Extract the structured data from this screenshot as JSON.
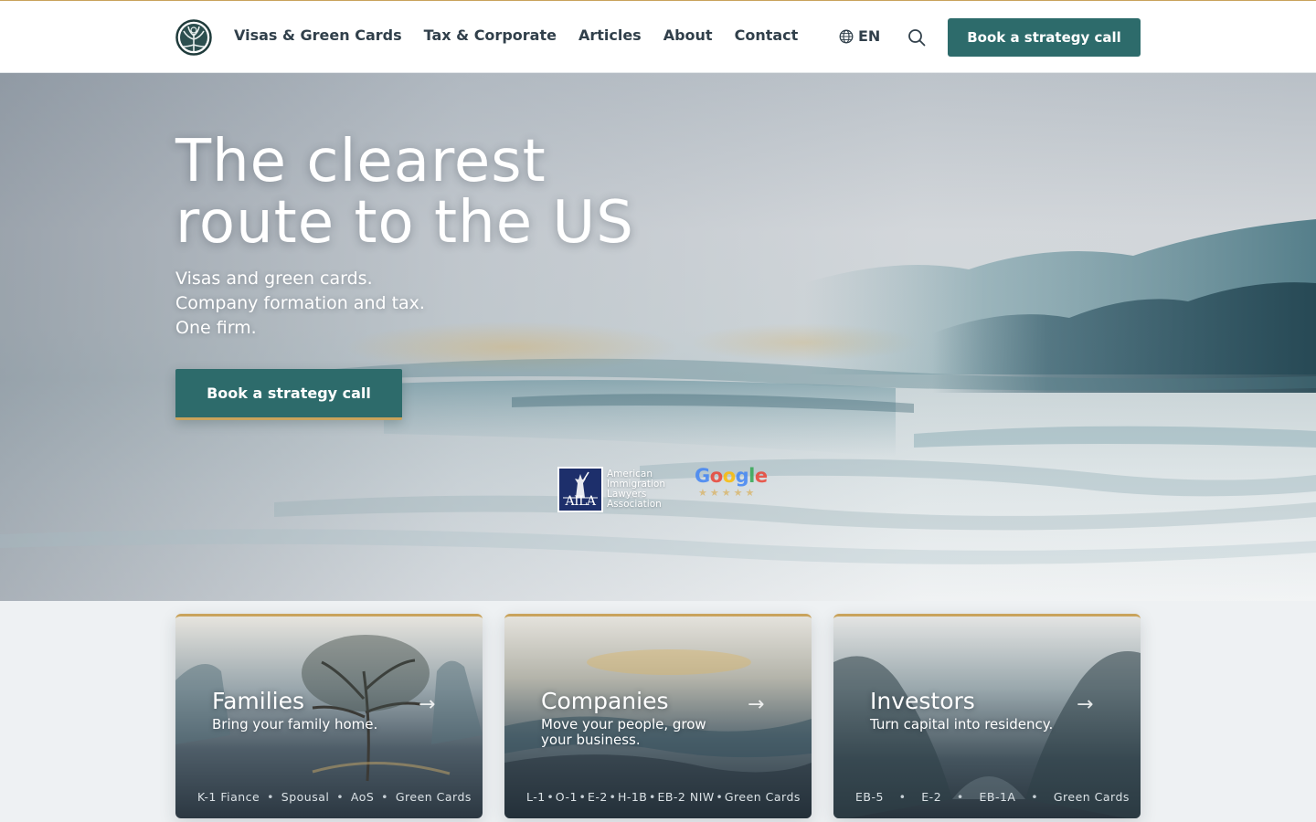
{
  "header": {
    "nav": [
      "Visas & Green Cards",
      "Tax & Corporate",
      "Articles",
      "About",
      "Contact"
    ],
    "language": "EN",
    "cta": "Book a strategy call"
  },
  "hero": {
    "title_line1": "The clearest",
    "title_line2": "route to the US",
    "subtitle_lines": [
      "Visas and green cards.",
      "Company formation and tax.",
      "One firm."
    ],
    "cta": "Book a strategy call",
    "badges": {
      "aila_abbr": "AILA",
      "aila_lines": [
        "American",
        "Immigration",
        "Lawyers",
        "Association"
      ],
      "google_word": "Google",
      "google_stars": 5
    }
  },
  "cards": [
    {
      "title": "Families",
      "description": "Bring your family home.",
      "tags": [
        "K-1 Fiance",
        "Spousal",
        "AoS",
        "Green Cards"
      ]
    },
    {
      "title": "Companies",
      "description": "Move your people, grow your business.",
      "tags": [
        "L-1",
        "O-1",
        "E-2",
        "H-1B",
        "EB-2 NIW",
        "Green Cards"
      ]
    },
    {
      "title": "Investors",
      "description": "Turn capital into residency.",
      "tags": [
        "EB-5",
        "E-2",
        "EB-1A",
        "Green Cards"
      ]
    }
  ],
  "colors": {
    "accent": "#2d6b6b",
    "gold": "#c9a35c",
    "nav_text": "#31404b"
  },
  "icons": {
    "logo": "tree-of-life-icon",
    "language": "globe-icon",
    "search": "search-icon",
    "card_arrow": "arrow-right-icon"
  }
}
